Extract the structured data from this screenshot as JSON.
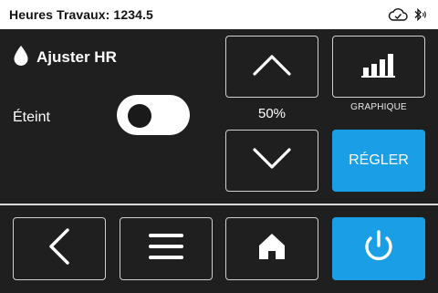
{
  "status_bar": {
    "title": "Heures Travaux: 1234.5",
    "icons": [
      "cloud-check-icon",
      "bluetooth-icon"
    ]
  },
  "panel": {
    "title": "Ajuster HR",
    "title_icon": "droplet-icon",
    "power_state_label": "Éteint",
    "toggle_on": false
  },
  "controls": {
    "increase_icon": "chevron-up-icon",
    "decrease_icon": "chevron-down-icon",
    "value": "50%",
    "graph_icon": "bar-chart-icon",
    "graph_label": "GRAPHIQUE",
    "set_label": "RÉGLER"
  },
  "nav": {
    "back_icon": "back-arrow-icon",
    "menu_icon": "hamburger-menu-icon",
    "home_icon": "home-icon",
    "power_icon": "power-icon"
  },
  "colors": {
    "background": "#1f1f1f",
    "accent": "#1a9ee6",
    "status_bar": "#ffffff"
  }
}
